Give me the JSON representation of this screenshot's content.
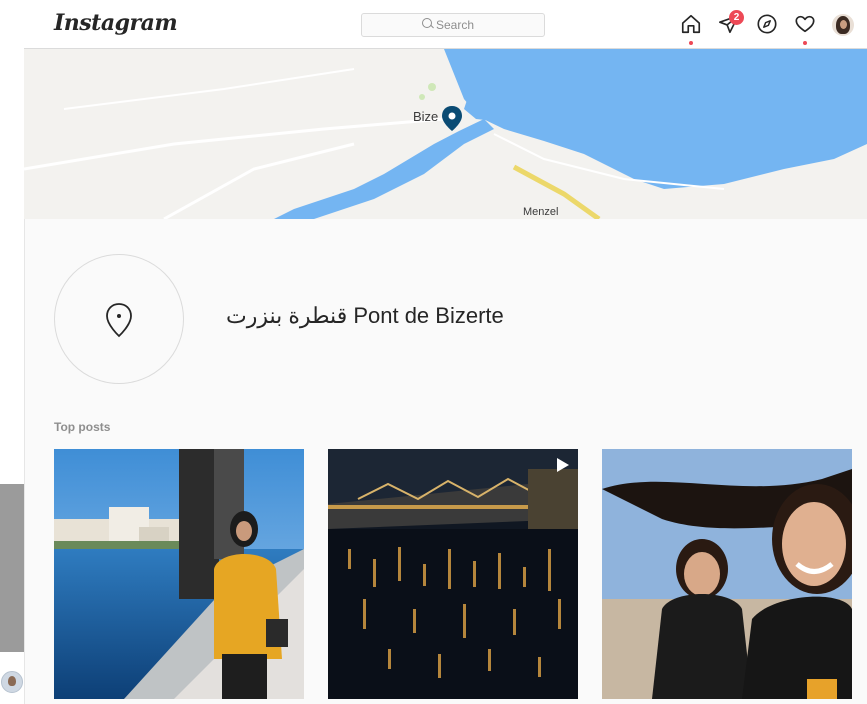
{
  "header": {
    "logo": "Instagram",
    "search_placeholder": "Search",
    "direct_badge": "2",
    "icons": [
      "home-icon",
      "direct-icon",
      "explore-icon",
      "activity-heart-icon",
      "profile-avatar"
    ]
  },
  "map": {
    "label_city": "Bize",
    "label_menzel": "Menzel",
    "colors": {
      "water": "#74b5f2",
      "land": "#f3f2ef",
      "road": "#ecd86a",
      "pin": "#0a4b73"
    }
  },
  "location": {
    "name": "قنطرة بنزرت Pont de Bizerte"
  },
  "sections": {
    "top_posts_label": "Top posts"
  },
  "posts": [
    {
      "alt": "woman-on-bridge-post",
      "type": "image"
    },
    {
      "alt": "bridge-at-night-post",
      "type": "video"
    },
    {
      "alt": "two-girls-smiling-post",
      "type": "image"
    }
  ]
}
